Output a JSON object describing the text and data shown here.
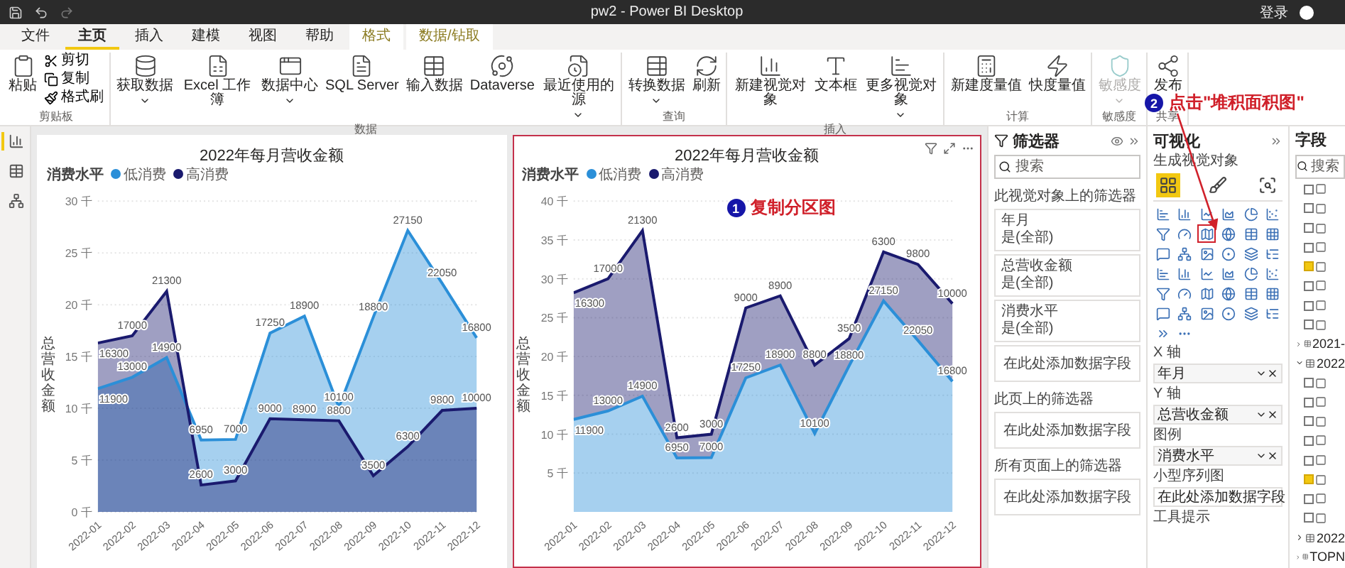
{
  "window": {
    "title": "pw2 - Power BI Desktop",
    "sign_in": "登录"
  },
  "menu_tabs": [
    {
      "label": "文件",
      "selected": false,
      "kind": "normal"
    },
    {
      "label": "主页",
      "selected": true,
      "kind": "normal"
    },
    {
      "label": "插入",
      "selected": false,
      "kind": "normal"
    },
    {
      "label": "建模",
      "selected": false,
      "kind": "normal"
    },
    {
      "label": "视图",
      "selected": false,
      "kind": "normal"
    },
    {
      "label": "帮助",
      "selected": false,
      "kind": "normal"
    },
    {
      "label": "格式",
      "selected": false,
      "kind": "contextual"
    },
    {
      "label": "数据/钻取",
      "selected": false,
      "kind": "contextual"
    }
  ],
  "ribbon": [
    {
      "label": "剪贴板",
      "buttons": [
        {
          "label": "粘贴",
          "kind": "large"
        },
        {
          "label": "剪切",
          "kind": "small"
        },
        {
          "label": "复制",
          "kind": "small"
        },
        {
          "label": "格式刷",
          "kind": "small"
        }
      ]
    },
    {
      "label": "数据",
      "buttons": [
        {
          "label": "获取数据",
          "kind": "large",
          "dropdown": true
        },
        {
          "label": "Excel 工作簿",
          "kind": "large"
        },
        {
          "label": "数据中心",
          "kind": "large",
          "dropdown": true
        },
        {
          "label": "SQL Server",
          "kind": "large"
        },
        {
          "label": "输入数据",
          "kind": "large"
        },
        {
          "label": "Dataverse",
          "kind": "large"
        },
        {
          "label": "最近使用的源",
          "kind": "large",
          "dropdown": true
        }
      ]
    },
    {
      "label": "查询",
      "buttons": [
        {
          "label": "转换数据",
          "kind": "large",
          "dropdown": true
        },
        {
          "label": "刷新",
          "kind": "large"
        }
      ]
    },
    {
      "label": "插入",
      "buttons": [
        {
          "label": "新建视觉对象",
          "kind": "large"
        },
        {
          "label": "文本框",
          "kind": "large"
        },
        {
          "label": "更多视觉对象",
          "kind": "large",
          "dropdown": true
        }
      ]
    },
    {
      "label": "计算",
      "buttons": [
        {
          "label": "新建度量值",
          "kind": "large"
        },
        {
          "label": "快度量值",
          "kind": "large"
        }
      ]
    },
    {
      "label": "敏感度",
      "buttons": [
        {
          "label": "敏感度",
          "kind": "large",
          "dropdown": true,
          "disabled": true
        }
      ]
    },
    {
      "label": "共享",
      "buttons": [
        {
          "label": "发布",
          "kind": "large"
        }
      ]
    }
  ],
  "page_views": [
    {
      "selected": true
    },
    {
      "selected": false
    },
    {
      "selected": false
    }
  ],
  "visuals": [
    {
      "title": "2022年每月营收金额",
      "selected": false,
      "legend_title": "消费水平",
      "chart_data": {
        "type": "area",
        "stacked": false,
        "ylabel": "总营收金额",
        "categories": [
          "2022-01",
          "2022-02",
          "2022-03",
          "2022-04",
          "2022-05",
          "2022-06",
          "2022-07",
          "2022-08",
          "2022-09",
          "2022-10",
          "2022-11",
          "2022-12"
        ],
        "series": [
          {
            "name": "低消费",
            "color": "#2b8fd8",
            "values": [
              11.9,
              13,
              14.9,
              6.95,
              7,
              17.25,
              18.9,
              10.1,
              18.8,
              27.15,
              22.05,
              16.8
            ]
          },
          {
            "name": "高消费",
            "color": "#1a1a6e",
            "values": [
              16.3,
              17,
              21.3,
              2.6,
              3,
              9,
              8.9,
              8.8,
              3.5,
              6.3,
              9.8,
              10
            ]
          }
        ],
        "value_labels": [
          [
            "11900",
            "13000",
            "14900",
            "6950",
            "7000",
            "17250",
            "18900",
            "10100",
            "18800",
            "27150",
            "22050",
            "16800"
          ],
          [
            "16300",
            "17000",
            "21300",
            "2600",
            "3000",
            "9000",
            "8900",
            "8800",
            "3500",
            "6300",
            "9800",
            "10000"
          ]
        ],
        "ylim": [
          0,
          30
        ],
        "yticks": [
          {
            "value": 0,
            "label": "0 千"
          },
          {
            "value": 5,
            "label": "5 千"
          },
          {
            "value": 10,
            "label": "10 千"
          },
          {
            "value": 15,
            "label": "15 千"
          },
          {
            "value": 20,
            "label": "20 千"
          },
          {
            "value": 25,
            "label": "25 千"
          },
          {
            "value": 30,
            "label": "30 千"
          }
        ],
        "grid": true
      }
    },
    {
      "title": "2022年每月营收金额",
      "selected": true,
      "legend_title": "消费水平",
      "callout": {
        "number": "1",
        "text": "复制分区图"
      },
      "chart_data": {
        "type": "area",
        "stacked": true,
        "ylabel": "总营收金额",
        "categories": [
          "2022-01",
          "2022-02",
          "2022-03",
          "2022-04",
          "2022-05",
          "2022-06",
          "2022-07",
          "2022-08",
          "2022-09",
          "2022-10",
          "2022-11",
          "2022-12"
        ],
        "series": [
          {
            "name": "低消费",
            "color": "#2b8fd8",
            "values": [
              11.9,
              13,
              14.9,
              6.95,
              7,
              17.25,
              18.9,
              10.1,
              18.8,
              27.15,
              22.05,
              16.8
            ]
          },
          {
            "name": "高消费",
            "color": "#1a1a6e",
            "values": [
              16.3,
              17,
              21.3,
              2.6,
              3,
              9,
              8.9,
              8.8,
              3.5,
              6.3,
              9.8,
              10
            ]
          }
        ],
        "value_labels": [
          [
            "11900",
            "13000",
            "14900",
            "6950",
            "7000",
            "17250",
            "18900",
            "10100",
            "18800",
            "27150",
            "22050",
            "16800"
          ],
          [
            "16300",
            "17000",
            "21300",
            "2600",
            "3000",
            "9000",
            "8900",
            "8800",
            "3500",
            "6300",
            "9800",
            "10000"
          ]
        ],
        "ylim": [
          0,
          40
        ],
        "yticks": [
          {
            "value": 5,
            "label": "5 千"
          },
          {
            "value": 10,
            "label": "10 千"
          },
          {
            "value": 15,
            "label": "15 千"
          },
          {
            "value": 20,
            "label": "20 千"
          },
          {
            "value": 25,
            "label": "25 千"
          },
          {
            "value": 30,
            "label": "30 千"
          },
          {
            "value": 35,
            "label": "35 千"
          },
          {
            "value": 40,
            "label": "40 千"
          }
        ],
        "grid": true
      }
    }
  ],
  "filters": {
    "title": "筛选器",
    "search": {
      "placeholder": "搜索"
    },
    "sections": [
      {
        "title": "此视觉对象上的筛选器",
        "cards": [
          {
            "name": "年月",
            "value": "是(全部)"
          },
          {
            "name": "总营收金额",
            "value": "是(全部)"
          },
          {
            "name": "消费水平",
            "value": "是(全部)"
          }
        ],
        "drop_zone": "在此处添加数据字段"
      },
      {
        "title": "此页上的筛选器",
        "drop_zone": "在此处添加数据字段"
      },
      {
        "title": "所有页面上的筛选器",
        "drop_zone": "在此处添加数据字段"
      }
    ]
  },
  "visualizations": {
    "title": "可视化",
    "subtitle": "生成视觉对象",
    "tabs": [
      {
        "selected": true
      },
      {
        "selected": false
      },
      {
        "selected": false
      }
    ],
    "types": [
      {
        "selected": false
      },
      {
        "selected": false
      },
      {
        "selected": false
      },
      {
        "selected": false
      },
      {
        "selected": false
      },
      {
        "selected": false
      },
      {
        "selected": false
      },
      {
        "selected": false
      },
      {
        "selected": true
      },
      {
        "selected": false
      },
      {
        "selected": false
      },
      {
        "selected": false
      },
      {
        "selected": false
      },
      {
        "selected": false
      },
      {
        "selected": false
      },
      {
        "selected": false
      },
      {
        "selected": false
      },
      {
        "selected": false
      },
      {
        "selected": false
      },
      {
        "selected": false
      },
      {
        "selected": false
      },
      {
        "selected": false
      },
      {
        "selected": false
      },
      {
        "selected": false
      },
      {
        "selected": false
      },
      {
        "selected": false
      },
      {
        "selected": false
      },
      {
        "selected": false
      },
      {
        "selected": false
      },
      {
        "selected": false
      },
      {
        "selected": false
      },
      {
        "selected": false
      },
      {
        "selected": false
      },
      {
        "selected": false
      },
      {
        "selected": false
      },
      {
        "selected": false
      },
      {
        "selected": false,
        "kind": "chevrons"
      },
      {
        "selected": false,
        "kind": "more"
      }
    ],
    "wells": [
      {
        "label": "X 轴",
        "value": "年月"
      },
      {
        "label": "Y 轴",
        "value": "总营收金额"
      },
      {
        "label": "图例",
        "value": "消费水平"
      },
      {
        "label": "小型序列图",
        "placeholder": "在此处添加数据字段"
      },
      {
        "label": "工具提示"
      }
    ]
  },
  "fields": {
    "title": "字段",
    "search": {
      "placeholder": "搜索"
    },
    "items": [
      {
        "kind": "field",
        "checked": false
      },
      {
        "kind": "field",
        "checked": false
      },
      {
        "kind": "field",
        "checked": false
      },
      {
        "kind": "field",
        "checked": false
      },
      {
        "kind": "field",
        "checked": true
      },
      {
        "kind": "field",
        "checked": false
      },
      {
        "kind": "field",
        "checked": false
      },
      {
        "kind": "field",
        "checked": false
      },
      {
        "kind": "table",
        "label": "2021-",
        "expanded": false
      },
      {
        "kind": "table",
        "label": "2022",
        "expanded": true
      },
      {
        "kind": "field",
        "checked": false
      },
      {
        "kind": "field",
        "checked": false
      },
      {
        "kind": "field",
        "checked": false
      },
      {
        "kind": "field",
        "checked": false
      },
      {
        "kind": "field",
        "checked": false
      },
      {
        "kind": "field",
        "checked": true
      },
      {
        "kind": "field",
        "checked": false
      },
      {
        "kind": "field",
        "checked": false
      },
      {
        "kind": "table",
        "label": "2022",
        "expanded": false
      },
      {
        "kind": "table",
        "label": "TOPN",
        "expanded": false
      }
    ]
  },
  "callout": {
    "number": "2",
    "text": "点击\"堆积面积图\""
  }
}
